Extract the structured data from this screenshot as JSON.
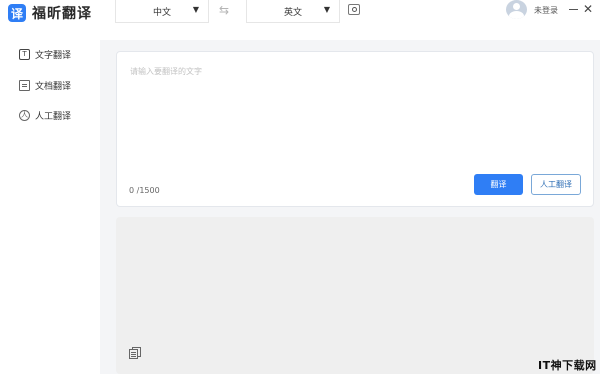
{
  "app": {
    "logo_mark": "译",
    "name": "福昕翻译"
  },
  "header": {
    "source_language": "中文",
    "target_language": "英文",
    "login_label": "未登录",
    "close_glyph": "✕"
  },
  "sidebar": {
    "items": [
      {
        "label": "文字翻译",
        "icon": "text-icon",
        "active": true
      },
      {
        "label": "文档翻译",
        "icon": "document-icon",
        "active": false
      },
      {
        "label": "人工翻译",
        "icon": "person-icon",
        "active": false
      }
    ]
  },
  "input": {
    "placeholder": "请输入要翻译的文字",
    "counter": "0 /1500",
    "translate_label": "翻译",
    "human_translate_label": "人工翻译"
  },
  "watermark": "IT神下载网",
  "colors": {
    "accent": "#2f7ef5",
    "output_bg": "#efefef"
  }
}
